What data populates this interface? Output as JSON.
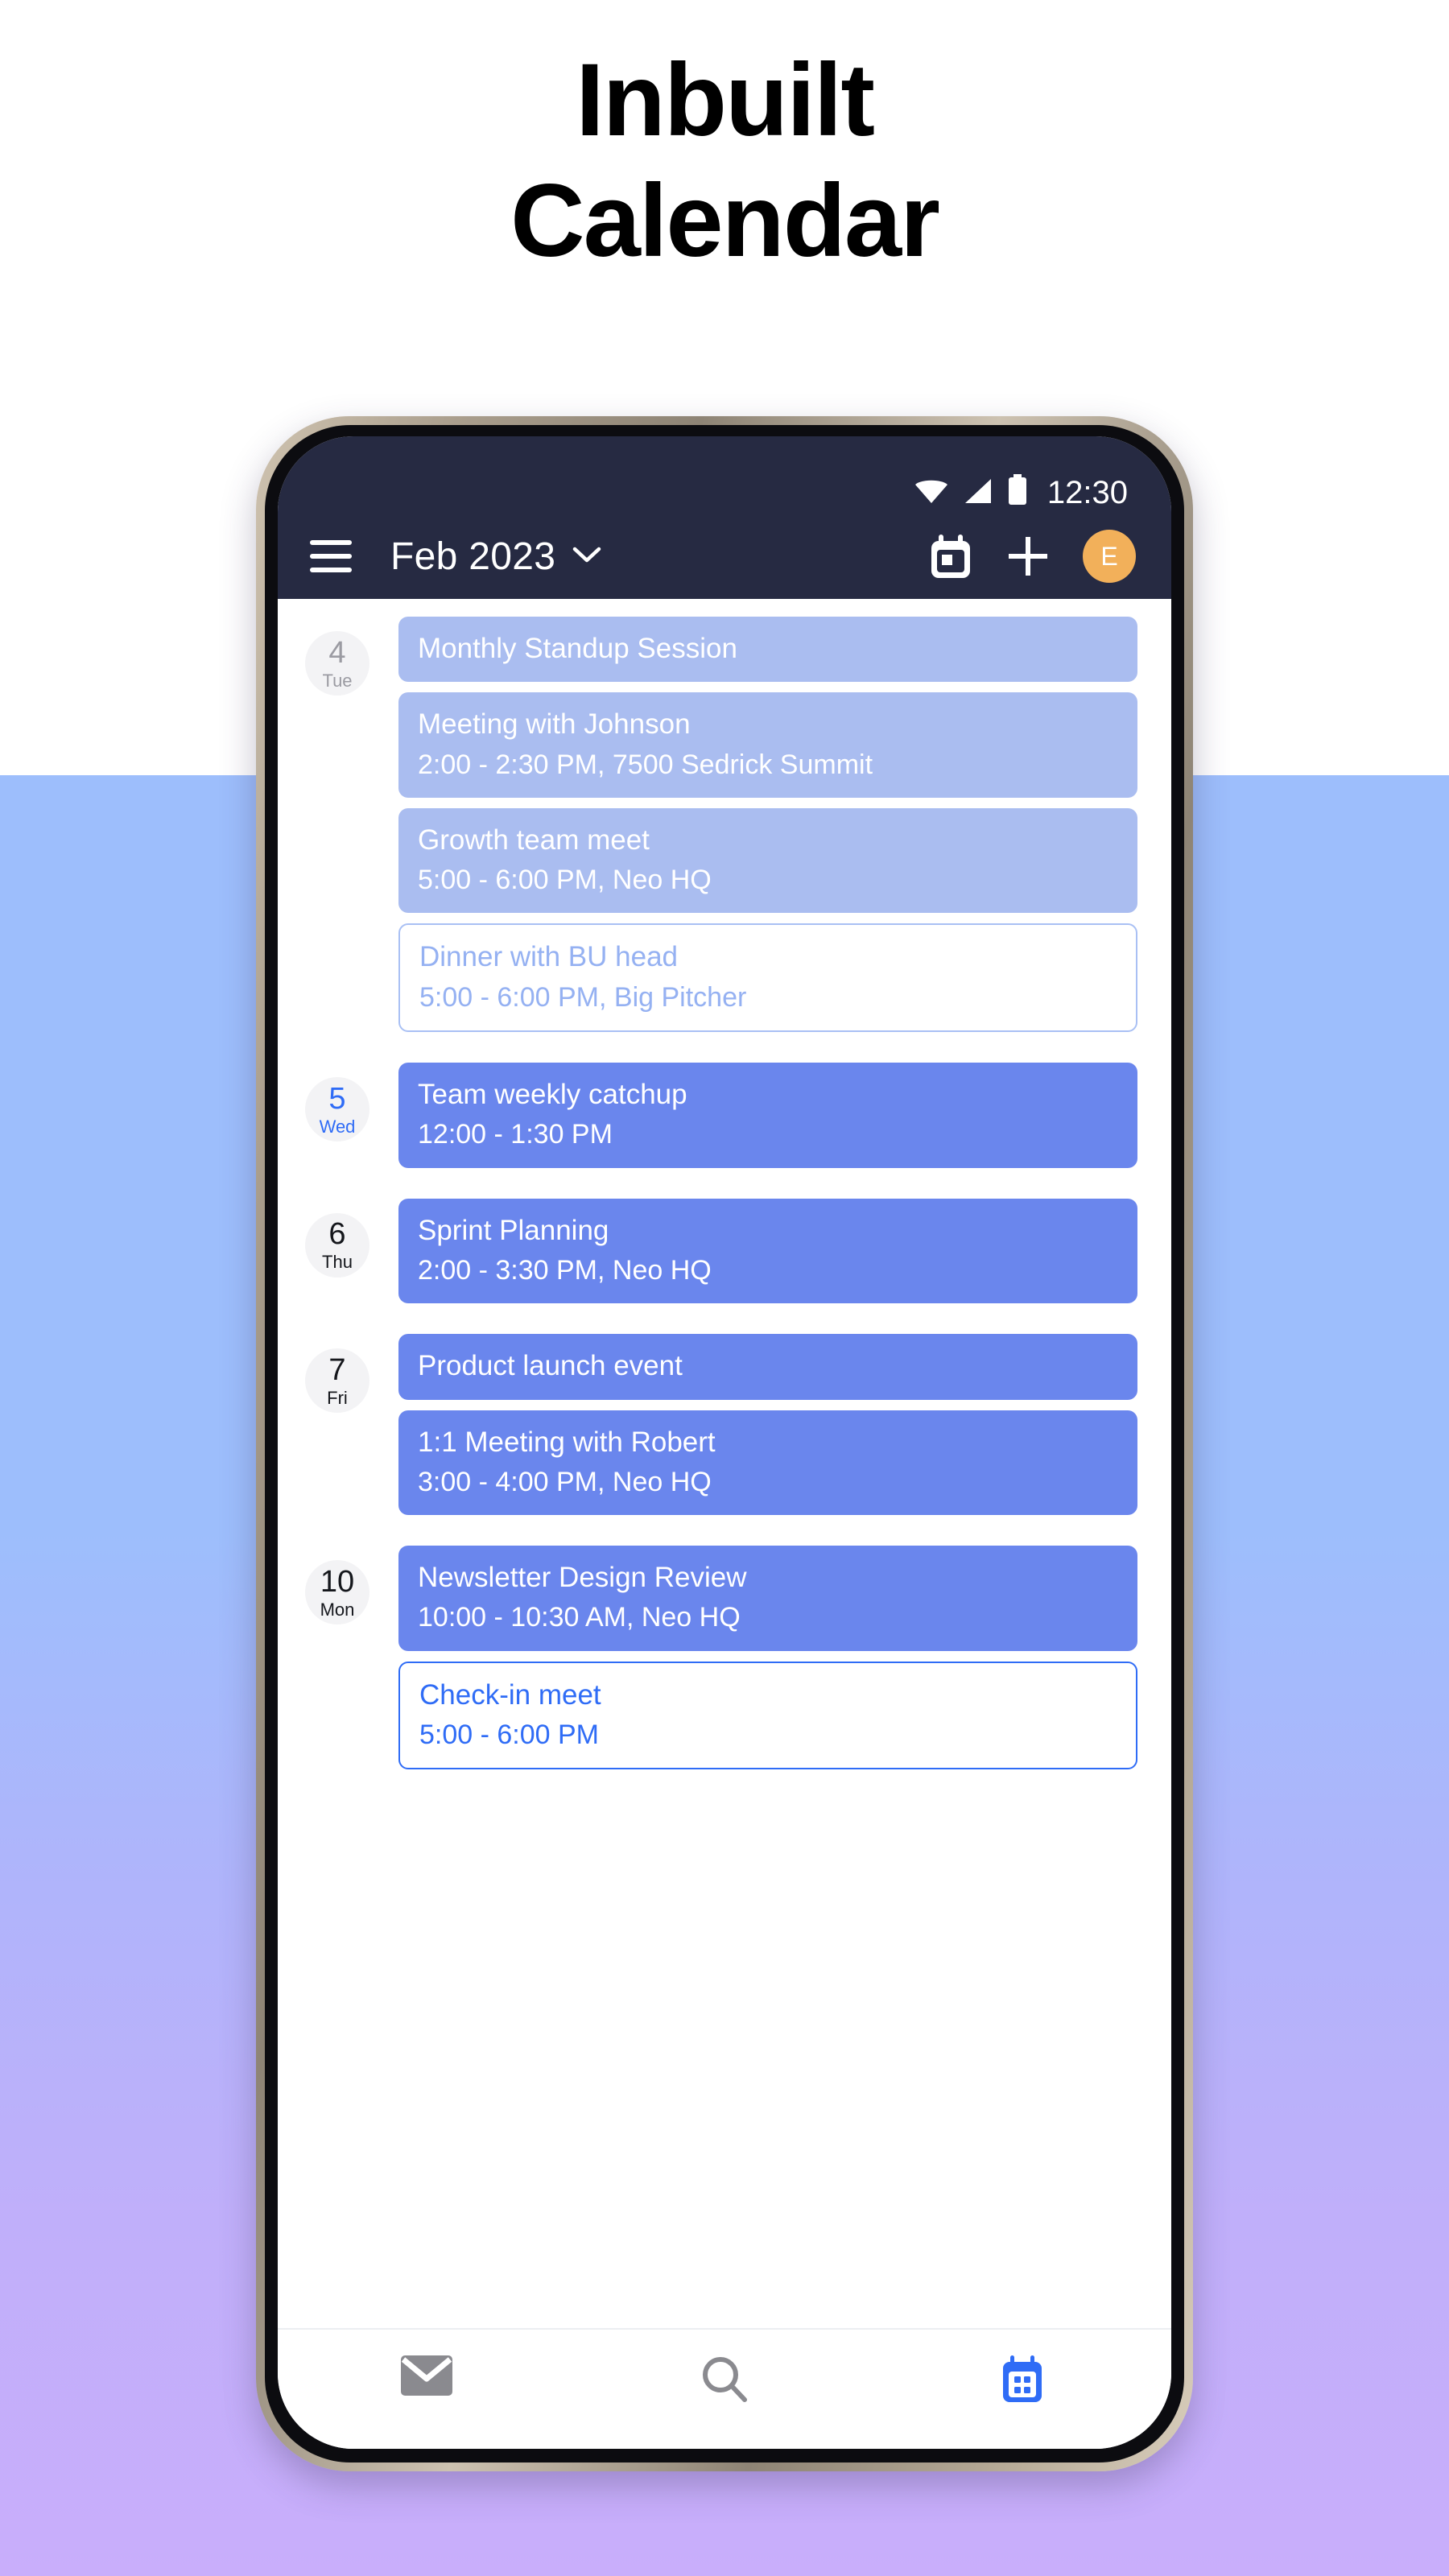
{
  "headline": {
    "line1": "Inbuilt",
    "line2": "Calendar"
  },
  "theme": {
    "appbar_bg": "#262a42",
    "accent_strong": "#2f6cf6",
    "event_solid_strong": "#6a86ed",
    "event_solid_muted": "#aabdf0",
    "avatar_bg": "#f2b05a",
    "bg_gradient_top": "#9dbefc",
    "bg_gradient_bottom": "#c9aefb"
  },
  "status_bar": {
    "time": "12:30",
    "icons": [
      "wifi-icon",
      "cellular-signal-icon",
      "battery-icon"
    ]
  },
  "app_bar": {
    "menu_icon": "hamburger-menu-icon",
    "month_label": "Feb 2023",
    "month_chevron_icon": "chevron-down-icon",
    "calendar_view_icon": "calendar-icon",
    "add_event_icon": "plus-icon",
    "avatar_initial": "E"
  },
  "agenda": {
    "days": [
      {
        "num": "4",
        "dow": "Tue",
        "state": "past",
        "events": [
          {
            "title": "Monthly Standup Session",
            "sub": "",
            "style": "solid-muted"
          },
          {
            "title": "Meeting with Johnson",
            "sub": "2:00 - 2:30 PM, 7500 Sedrick Summit",
            "style": "solid-muted"
          },
          {
            "title": "Growth team meet",
            "sub": "5:00 - 6:00 PM, Neo HQ",
            "style": "solid-muted"
          },
          {
            "title": "Dinner with BU head",
            "sub": "5:00 - 6:00 PM, Big Pitcher",
            "style": "outline-muted"
          }
        ]
      },
      {
        "num": "5",
        "dow": "Wed",
        "state": "today",
        "events": [
          {
            "title": "Team weekly catchup",
            "sub": "12:00 - 1:30 PM",
            "style": "solid-strong"
          }
        ]
      },
      {
        "num": "6",
        "dow": "Thu",
        "state": "normal",
        "events": [
          {
            "title": "Sprint Planning",
            "sub": "2:00 - 3:30 PM, Neo HQ",
            "style": "solid-strong"
          }
        ]
      },
      {
        "num": "7",
        "dow": "Fri",
        "state": "normal",
        "events": [
          {
            "title": "Product launch event",
            "sub": "",
            "style": "solid-strong"
          },
          {
            "title": "1:1 Meeting with Robert",
            "sub": "3:00 - 4:00 PM, Neo HQ",
            "style": "solid-strong"
          }
        ]
      },
      {
        "num": "10",
        "dow": "Mon",
        "state": "normal",
        "events": [
          {
            "title": "Newsletter Design Review",
            "sub": "10:00 - 10:30 AM, Neo HQ",
            "style": "solid-strong"
          },
          {
            "title": "Check-in meet",
            "sub": "5:00 - 6:00 PM",
            "style": "outline-strong"
          }
        ]
      }
    ]
  },
  "bottom_nav": {
    "items": [
      {
        "icon": "mail-icon",
        "active": false
      },
      {
        "icon": "search-icon",
        "active": false
      },
      {
        "icon": "calendar-icon",
        "active": true
      }
    ]
  }
}
